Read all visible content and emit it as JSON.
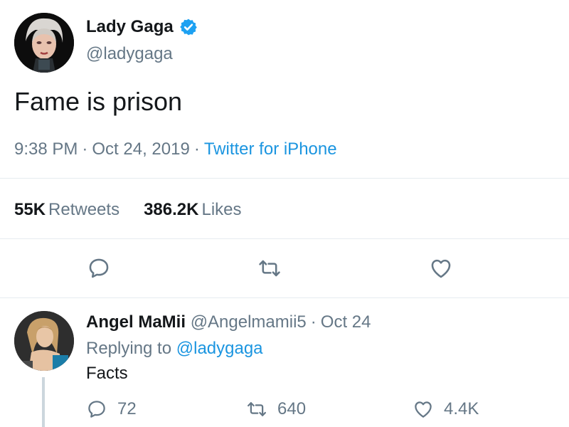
{
  "tweet": {
    "display_name": "Lady Gaga",
    "handle": "@ladygaga",
    "verified_icon": "verified-badge-icon",
    "text": "Fame is prison",
    "time": "9:38 PM",
    "date": "Oct 24, 2019",
    "separator": "·",
    "source": "Twitter for iPhone",
    "retweets_count": "55K",
    "retweets_label": "Retweets",
    "likes_count": "386.2K",
    "likes_label": "Likes",
    "actions": [
      "reply-icon",
      "retweet-icon",
      "like-icon"
    ]
  },
  "reply": {
    "display_name": "Angel MaMii",
    "handle": "@Angelmamii5",
    "separator": "·",
    "date": "Oct 24",
    "replying_to_label": "Replying to",
    "replying_to_handle": "@ladygaga",
    "text": "Facts",
    "reply_count": "72",
    "retweet_count": "640",
    "like_count": "4.4K"
  },
  "colors": {
    "text": "#14171a",
    "secondary": "#657786",
    "link": "#1b95e0",
    "verified": "#1da1f2",
    "divider": "#e6ecf0"
  }
}
